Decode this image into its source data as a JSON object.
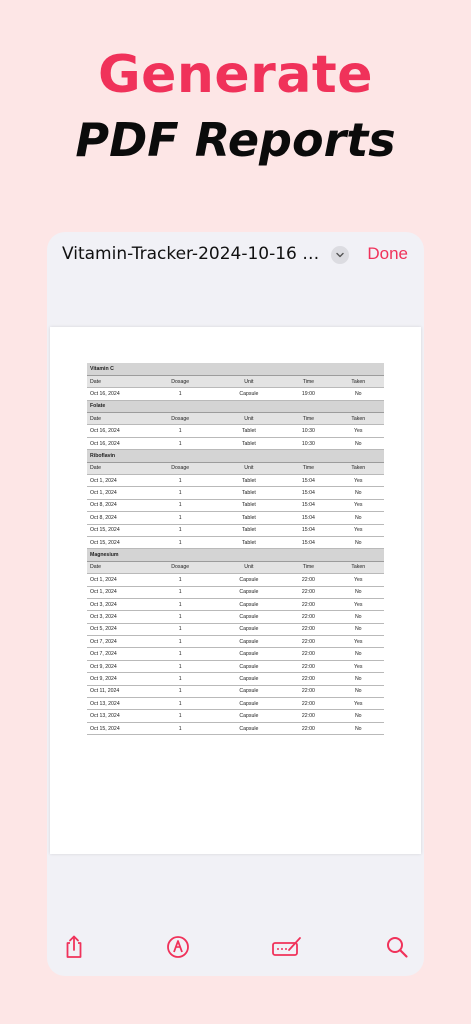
{
  "hero": {
    "line1": "Generate",
    "line2": "PDF Reports"
  },
  "nav": {
    "title": "Vitamin-Tracker-2024-10-16 16:...",
    "chevron_icon": "chevron-down-icon",
    "done_label": "Done"
  },
  "colors": {
    "accent": "#f0325a",
    "background": "#fde6e6"
  },
  "report": {
    "columns": [
      "Date",
      "Dosage",
      "Unit",
      "Time",
      "Taken"
    ],
    "sections": [
      {
        "name": "Vitamin C",
        "rows": [
          [
            "Oct 16, 2024",
            "1",
            "Capsule",
            "19:00",
            "No"
          ]
        ]
      },
      {
        "name": "Folate",
        "rows": [
          [
            "Oct 16, 2024",
            "1",
            "Tablet",
            "10:30",
            "Yes"
          ],
          [
            "Oct 16, 2024",
            "1",
            "Tablet",
            "10:30",
            "No"
          ]
        ]
      },
      {
        "name": "Riboflavin",
        "rows": [
          [
            "Oct 1, 2024",
            "1",
            "Tablet",
            "15:04",
            "Yes"
          ],
          [
            "Oct 1, 2024",
            "1",
            "Tablet",
            "15:04",
            "No"
          ],
          [
            "Oct 8, 2024",
            "1",
            "Tablet",
            "15:04",
            "Yes"
          ],
          [
            "Oct 8, 2024",
            "1",
            "Tablet",
            "15:04",
            "No"
          ],
          [
            "Oct 15, 2024",
            "1",
            "Tablet",
            "15:04",
            "Yes"
          ],
          [
            "Oct 15, 2024",
            "1",
            "Tablet",
            "15:04",
            "No"
          ]
        ]
      },
      {
        "name": "Magnesium",
        "rows": [
          [
            "Oct 1, 2024",
            "1",
            "Capsule",
            "22:00",
            "Yes"
          ],
          [
            "Oct 1, 2024",
            "1",
            "Capsule",
            "22:00",
            "No"
          ],
          [
            "Oct 3, 2024",
            "1",
            "Capsule",
            "22:00",
            "Yes"
          ],
          [
            "Oct 3, 2024",
            "1",
            "Capsule",
            "22:00",
            "No"
          ],
          [
            "Oct 5, 2024",
            "1",
            "Capsule",
            "22:00",
            "No"
          ],
          [
            "Oct 7, 2024",
            "1",
            "Capsule",
            "22:00",
            "Yes"
          ],
          [
            "Oct 7, 2024",
            "1",
            "Capsule",
            "22:00",
            "No"
          ],
          [
            "Oct 9, 2024",
            "1",
            "Capsule",
            "22:00",
            "Yes"
          ],
          [
            "Oct 9, 2024",
            "1",
            "Capsule",
            "22:00",
            "No"
          ],
          [
            "Oct 11, 2024",
            "1",
            "Capsule",
            "22:00",
            "No"
          ],
          [
            "Oct 13, 2024",
            "1",
            "Capsule",
            "22:00",
            "Yes"
          ],
          [
            "Oct 13, 2024",
            "1",
            "Capsule",
            "22:00",
            "No"
          ],
          [
            "Oct 15, 2024",
            "1",
            "Capsule",
            "22:00",
            "No"
          ]
        ]
      }
    ]
  },
  "toolbar": {
    "icons": [
      "share-icon",
      "markup-pen-icon",
      "signature-icon",
      "search-icon"
    ]
  }
}
